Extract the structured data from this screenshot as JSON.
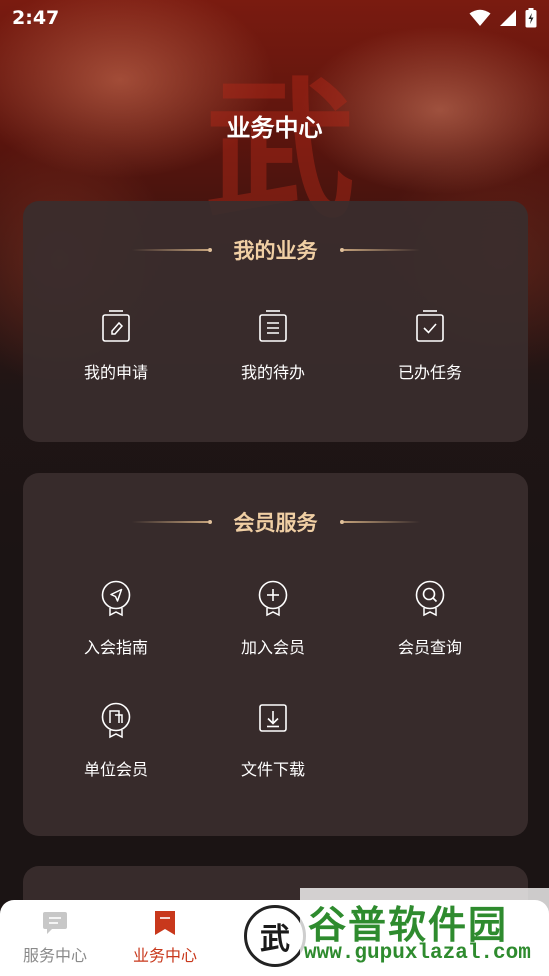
{
  "status_bar": {
    "time": "2:47"
  },
  "header": {
    "title": "业务中心"
  },
  "hero": {
    "glyph": "武"
  },
  "my_business": {
    "title": "我的业务",
    "items": [
      {
        "label": "我的申请",
        "icon": "edit-document-icon"
      },
      {
        "label": "我的待办",
        "icon": "todo-list-icon"
      },
      {
        "label": "已办任务",
        "icon": "check-document-icon"
      }
    ]
  },
  "member_services": {
    "title": "会员服务",
    "items": [
      {
        "label": "入会指南",
        "icon": "compass-badge-icon"
      },
      {
        "label": "加入会员",
        "icon": "plus-badge-icon"
      },
      {
        "label": "会员查询",
        "icon": "search-badge-icon"
      },
      {
        "label": "单位会员",
        "icon": "building-badge-icon"
      },
      {
        "label": "文件下载",
        "icon": "download-icon"
      }
    ]
  },
  "tabbar": {
    "tabs": [
      {
        "label": "服务中心",
        "icon": "chat-bubble-icon",
        "active": false
      },
      {
        "label": "业务中心",
        "icon": "bookmark-icon",
        "active": true
      }
    ],
    "center_logo_glyph": "武"
  },
  "watermark": {
    "title": "谷普软件园",
    "url": "www.gupuxlazal.com"
  },
  "colors": {
    "accent_gold": "#f0cfa4",
    "active_tab": "#c8381c",
    "inactive_tab": "#8a8a8a",
    "watermark_green": "#2e8b2e"
  }
}
